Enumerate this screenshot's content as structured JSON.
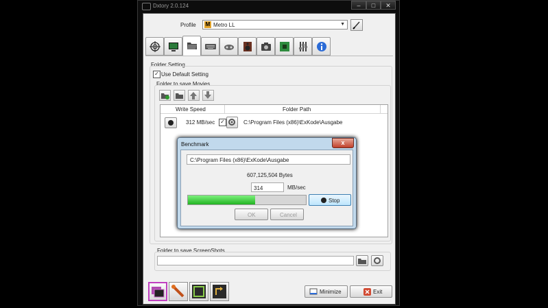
{
  "window": {
    "title": "Dxtory 2.0.124",
    "minimize_glyph": "–",
    "maximize_glyph": "□",
    "close_glyph": "✕"
  },
  "profile": {
    "label": "Profile",
    "value": "Metro LL",
    "logo_letter": "M"
  },
  "tabs": [
    "crosshair-icon",
    "monitor-icon",
    "folder-icon",
    "keyboard-icon",
    "controller-icon",
    "speaker-icon",
    "camera-icon",
    "chip-icon",
    "sliders-icon",
    "info-icon"
  ],
  "folder_setting": {
    "group_label": "Folder Setting",
    "use_default_label": "Use Default Setting",
    "use_default_checked": true
  },
  "movies": {
    "group_label": "Folder to save Movies",
    "columns": {
      "speed": "Write Speed",
      "path": "Folder Path"
    },
    "rows": [
      {
        "speed": "312 MB/sec",
        "enabled": true,
        "path": "C:\\Program Files (x86)\\ExKode\\Ausgabe"
      }
    ]
  },
  "benchmark": {
    "title": "Benchmark",
    "close_glyph": "x",
    "path": "C:\\Program Files (x86)\\ExKode\\Ausgabe",
    "bytes": "607,125,504 Bytes",
    "speed_value": "314",
    "speed_unit": "MB/sec",
    "progress": 0.57,
    "stop_label": "Stop",
    "ok_label": "OK",
    "cancel_label": "Cancel"
  },
  "screenshots": {
    "group_label": "Folder to save ScreenShots",
    "path": ""
  },
  "footer": {
    "minimize_label": "Minimize",
    "exit_label": "Exit",
    "bottom_buttons": [
      "windows-icon",
      "tools-icon",
      "media-icon",
      "export-icon"
    ]
  }
}
